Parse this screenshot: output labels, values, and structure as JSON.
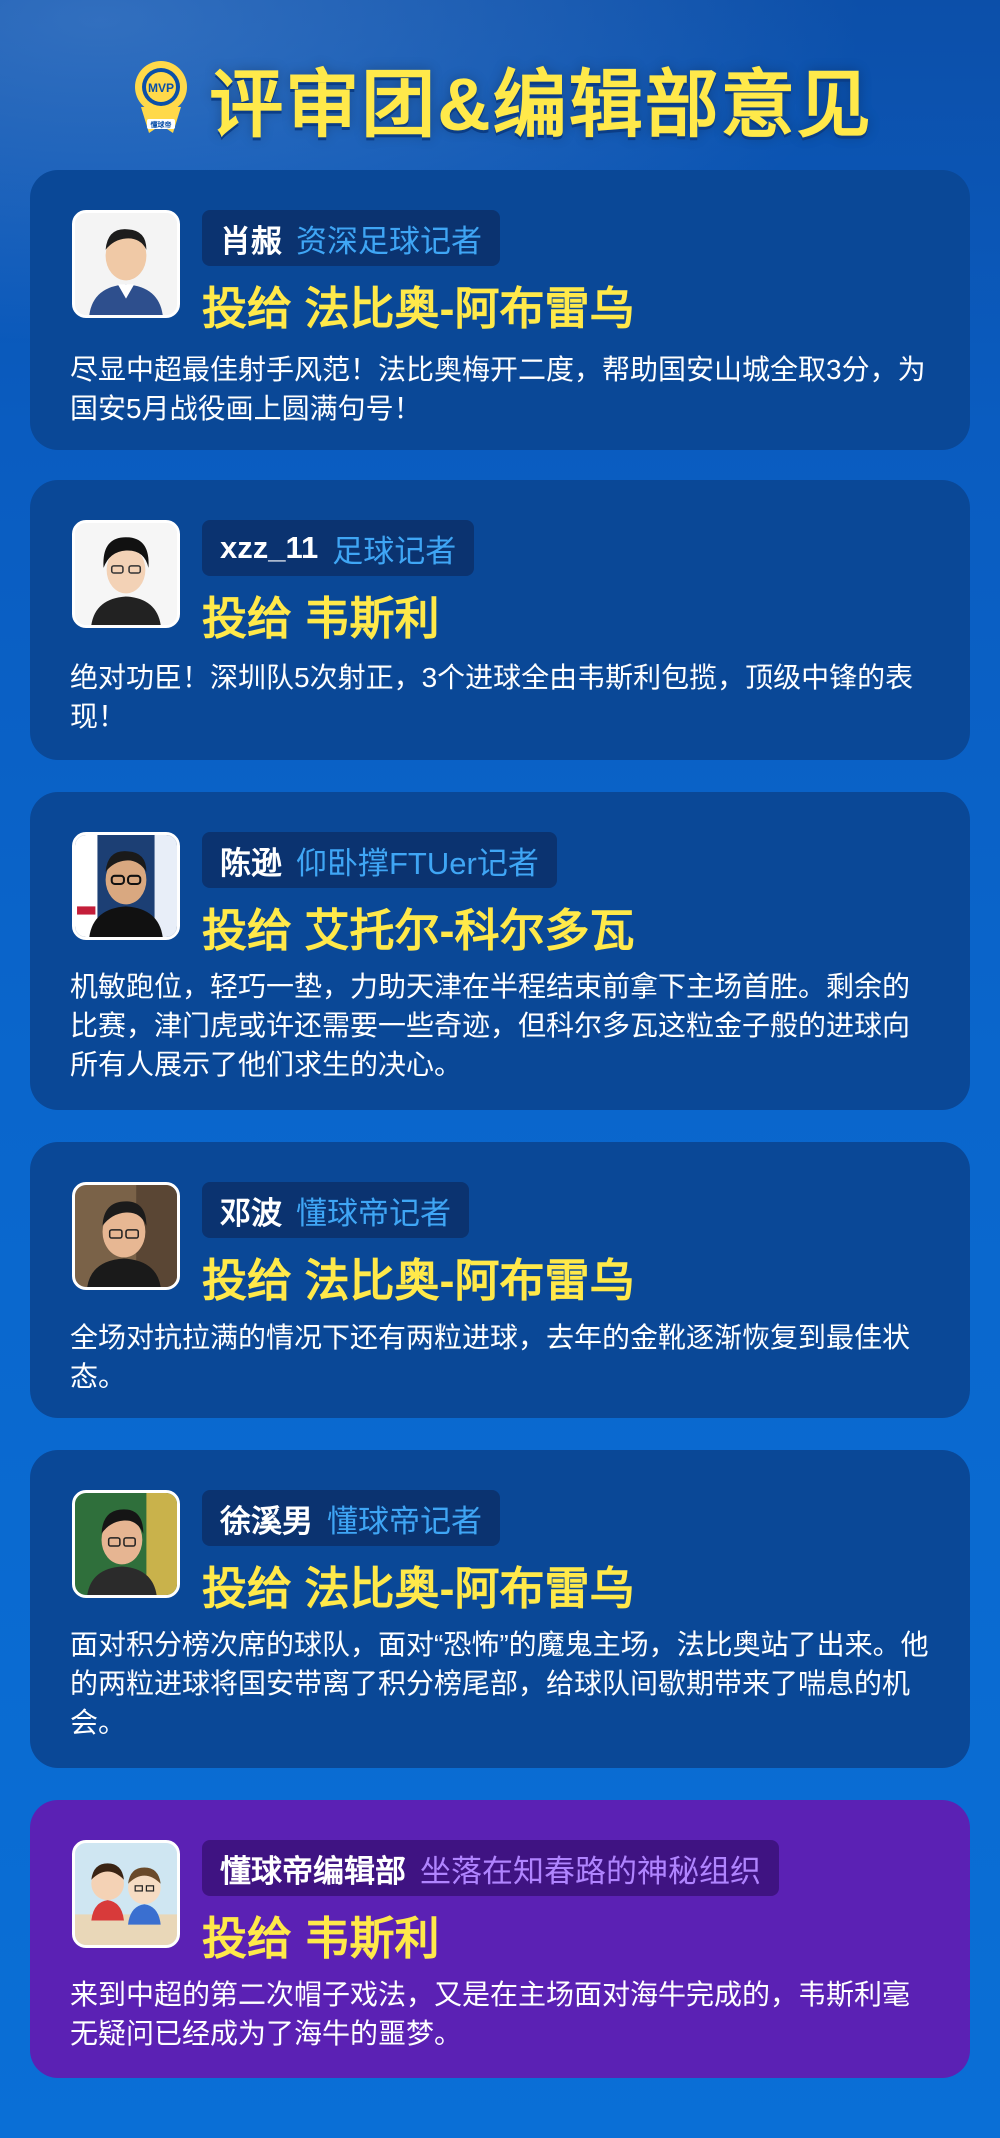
{
  "header": {
    "title": "评审团&编辑部意见",
    "logo": {
      "badge_text": "MVP",
      "sub_text": "懂球帝",
      "colors": {
        "gold": "#ffd94a",
        "white": "#ffffff"
      }
    }
  },
  "colors": {
    "card_blue": "#0a4897",
    "card_purple": "#5b21b4",
    "vote_yellow": "#ffe94a",
    "role_blue": "#3fa6f5",
    "role_purple": "#b084ff"
  },
  "cards": [
    {
      "name": "肖赧",
      "role": "资深足球记者",
      "vote": "投给 法比奥-阿布雷乌",
      "comment": "尽显中超最佳射手风范！法比奥梅开二度，帮助国安山城全取3分，为国安5月战役画上圆满句号！"
    },
    {
      "name": "xzz_11",
      "role": "足球记者",
      "vote": "投给 韦斯利",
      "comment": "绝对功臣！深圳队5次射正，3个进球全由韦斯利包揽，顶级中锋的表现！"
    },
    {
      "name": "陈逊",
      "role": "仰卧撑FTUer记者",
      "vote": "投给 艾托尔-科尔多瓦",
      "comment": "机敏跑位，轻巧一垫，力助天津在半程结束前拿下主场首胜。剩余的比赛，津门虎或许还需要一些奇迹，但科尔多瓦这粒金子般的进球向所有人展示了他们求生的决心。"
    },
    {
      "name": "邓波",
      "role": "懂球帝记者",
      "vote": "投给 法比奥-阿布雷乌",
      "comment": "全场对抗拉满的情况下还有两粒进球，去年的金靴逐渐恢复到最佳状态。"
    },
    {
      "name": "徐溪男",
      "role": "懂球帝记者",
      "vote": "投给 法比奥-阿布雷乌",
      "comment": "面对积分榜次席的球队，面对“恐怖”的魔鬼主场，法比奥站了出来。他的两粒进球将国安带离了积分榜尾部，给球队间歇期带来了喘息的机会。"
    },
    {
      "name": "懂球帝编辑部",
      "role": "坐落在知春路的神秘组织",
      "vote": "投给 韦斯利",
      "comment": "来到中超的第二次帽子戏法，又是在主场面对海牛完成的，韦斯利毫无疑问已经成为了海牛的噩梦。"
    }
  ]
}
